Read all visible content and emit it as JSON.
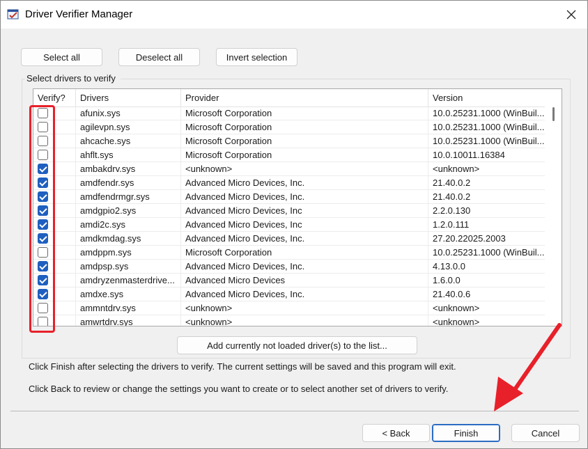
{
  "window": {
    "title": "Driver Verifier Manager"
  },
  "toolbar": {
    "select_all": "Select all",
    "deselect_all": "Deselect all",
    "invert_selection": "Invert selection"
  },
  "group": {
    "label": "Select drivers to verify"
  },
  "table": {
    "headers": [
      "Verify?",
      "Drivers",
      "Provider",
      "Version"
    ],
    "rows": [
      {
        "checked": false,
        "driver": "afunix.sys",
        "provider": "Microsoft Corporation",
        "version": "10.0.25231.1000 (WinBuil..."
      },
      {
        "checked": false,
        "driver": "agilevpn.sys",
        "provider": "Microsoft Corporation",
        "version": "10.0.25231.1000 (WinBuil..."
      },
      {
        "checked": false,
        "driver": "ahcache.sys",
        "provider": "Microsoft Corporation",
        "version": "10.0.25231.1000 (WinBuil..."
      },
      {
        "checked": false,
        "driver": "ahflt.sys",
        "provider": "Microsoft Corporation",
        "version": "10.0.10011.16384"
      },
      {
        "checked": true,
        "driver": "ambakdrv.sys",
        "provider": "<unknown>",
        "version": "<unknown>"
      },
      {
        "checked": true,
        "driver": "amdfendr.sys",
        "provider": "Advanced Micro Devices, Inc.",
        "version": "21.40.0.2"
      },
      {
        "checked": true,
        "driver": "amdfendrmgr.sys",
        "provider": "Advanced Micro Devices, Inc.",
        "version": "21.40.0.2"
      },
      {
        "checked": true,
        "driver": "amdgpio2.sys",
        "provider": "Advanced Micro Devices, Inc",
        "version": "2.2.0.130"
      },
      {
        "checked": true,
        "driver": "amdi2c.sys",
        "provider": "Advanced Micro Devices, Inc",
        "version": "1.2.0.111"
      },
      {
        "checked": true,
        "driver": "amdkmdag.sys",
        "provider": "Advanced Micro Devices, Inc.",
        "version": "27.20.22025.2003"
      },
      {
        "checked": false,
        "driver": "amdppm.sys",
        "provider": "Microsoft Corporation",
        "version": "10.0.25231.1000 (WinBuil..."
      },
      {
        "checked": true,
        "driver": "amdpsp.sys",
        "provider": "Advanced Micro Devices, Inc.",
        "version": "4.13.0.0"
      },
      {
        "checked": true,
        "driver": "amdryzenmasterdrive...",
        "provider": "Advanced Micro Devices",
        "version": "1.6.0.0"
      },
      {
        "checked": true,
        "driver": "amdxe.sys",
        "provider": "Advanced Micro Devices, Inc.",
        "version": "21.40.0.6"
      },
      {
        "checked": false,
        "driver": "ammntdrv.sys",
        "provider": "<unknown>",
        "version": "<unknown>"
      },
      {
        "checked": false,
        "driver": "amwrtdrv.sys",
        "provider": "<unknown>",
        "version": "<unknown>"
      }
    ]
  },
  "add_button": "Add currently not loaded driver(s) to the list...",
  "info": {
    "line1": "Click Finish after selecting the drivers to verify. The current settings will be saved and this program will exit.",
    "line2": "Click Back to review or change the settings you want to create or to select another set of drivers to verify."
  },
  "footer": {
    "back": "< Back",
    "finish": "Finish",
    "cancel": "Cancel"
  },
  "colors": {
    "accent": "#1f5fbf",
    "annotation": "#e8202a"
  },
  "icons": {
    "app": "driver-verifier-app-icon",
    "close": "close-icon"
  }
}
